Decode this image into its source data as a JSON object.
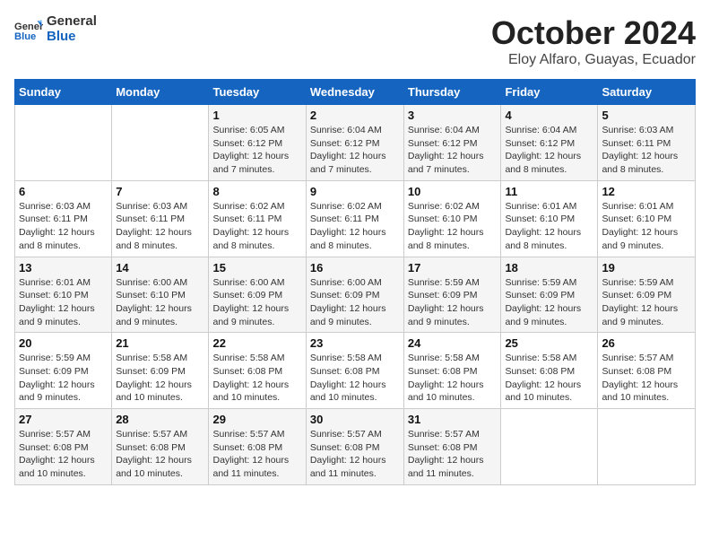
{
  "header": {
    "logo_line1": "General",
    "logo_line2": "Blue",
    "month_year": "October 2024",
    "location": "Eloy Alfaro, Guayas, Ecuador"
  },
  "calendar": {
    "days_of_week": [
      "Sunday",
      "Monday",
      "Tuesday",
      "Wednesday",
      "Thursday",
      "Friday",
      "Saturday"
    ],
    "weeks": [
      [
        {
          "day": "",
          "info": ""
        },
        {
          "day": "",
          "info": ""
        },
        {
          "day": "1",
          "info": "Sunrise: 6:05 AM\nSunset: 6:12 PM\nDaylight: 12 hours and 7 minutes."
        },
        {
          "day": "2",
          "info": "Sunrise: 6:04 AM\nSunset: 6:12 PM\nDaylight: 12 hours and 7 minutes."
        },
        {
          "day": "3",
          "info": "Sunrise: 6:04 AM\nSunset: 6:12 PM\nDaylight: 12 hours and 7 minutes."
        },
        {
          "day": "4",
          "info": "Sunrise: 6:04 AM\nSunset: 6:12 PM\nDaylight: 12 hours and 8 minutes."
        },
        {
          "day": "5",
          "info": "Sunrise: 6:03 AM\nSunset: 6:11 PM\nDaylight: 12 hours and 8 minutes."
        }
      ],
      [
        {
          "day": "6",
          "info": "Sunrise: 6:03 AM\nSunset: 6:11 PM\nDaylight: 12 hours and 8 minutes."
        },
        {
          "day": "7",
          "info": "Sunrise: 6:03 AM\nSunset: 6:11 PM\nDaylight: 12 hours and 8 minutes."
        },
        {
          "day": "8",
          "info": "Sunrise: 6:02 AM\nSunset: 6:11 PM\nDaylight: 12 hours and 8 minutes."
        },
        {
          "day": "9",
          "info": "Sunrise: 6:02 AM\nSunset: 6:11 PM\nDaylight: 12 hours and 8 minutes."
        },
        {
          "day": "10",
          "info": "Sunrise: 6:02 AM\nSunset: 6:10 PM\nDaylight: 12 hours and 8 minutes."
        },
        {
          "day": "11",
          "info": "Sunrise: 6:01 AM\nSunset: 6:10 PM\nDaylight: 12 hours and 8 minutes."
        },
        {
          "day": "12",
          "info": "Sunrise: 6:01 AM\nSunset: 6:10 PM\nDaylight: 12 hours and 9 minutes."
        }
      ],
      [
        {
          "day": "13",
          "info": "Sunrise: 6:01 AM\nSunset: 6:10 PM\nDaylight: 12 hours and 9 minutes."
        },
        {
          "day": "14",
          "info": "Sunrise: 6:00 AM\nSunset: 6:10 PM\nDaylight: 12 hours and 9 minutes."
        },
        {
          "day": "15",
          "info": "Sunrise: 6:00 AM\nSunset: 6:09 PM\nDaylight: 12 hours and 9 minutes."
        },
        {
          "day": "16",
          "info": "Sunrise: 6:00 AM\nSunset: 6:09 PM\nDaylight: 12 hours and 9 minutes."
        },
        {
          "day": "17",
          "info": "Sunrise: 5:59 AM\nSunset: 6:09 PM\nDaylight: 12 hours and 9 minutes."
        },
        {
          "day": "18",
          "info": "Sunrise: 5:59 AM\nSunset: 6:09 PM\nDaylight: 12 hours and 9 minutes."
        },
        {
          "day": "19",
          "info": "Sunrise: 5:59 AM\nSunset: 6:09 PM\nDaylight: 12 hours and 9 minutes."
        }
      ],
      [
        {
          "day": "20",
          "info": "Sunrise: 5:59 AM\nSunset: 6:09 PM\nDaylight: 12 hours and 9 minutes."
        },
        {
          "day": "21",
          "info": "Sunrise: 5:58 AM\nSunset: 6:09 PM\nDaylight: 12 hours and 10 minutes."
        },
        {
          "day": "22",
          "info": "Sunrise: 5:58 AM\nSunset: 6:08 PM\nDaylight: 12 hours and 10 minutes."
        },
        {
          "day": "23",
          "info": "Sunrise: 5:58 AM\nSunset: 6:08 PM\nDaylight: 12 hours and 10 minutes."
        },
        {
          "day": "24",
          "info": "Sunrise: 5:58 AM\nSunset: 6:08 PM\nDaylight: 12 hours and 10 minutes."
        },
        {
          "day": "25",
          "info": "Sunrise: 5:58 AM\nSunset: 6:08 PM\nDaylight: 12 hours and 10 minutes."
        },
        {
          "day": "26",
          "info": "Sunrise: 5:57 AM\nSunset: 6:08 PM\nDaylight: 12 hours and 10 minutes."
        }
      ],
      [
        {
          "day": "27",
          "info": "Sunrise: 5:57 AM\nSunset: 6:08 PM\nDaylight: 12 hours and 10 minutes."
        },
        {
          "day": "28",
          "info": "Sunrise: 5:57 AM\nSunset: 6:08 PM\nDaylight: 12 hours and 10 minutes."
        },
        {
          "day": "29",
          "info": "Sunrise: 5:57 AM\nSunset: 6:08 PM\nDaylight: 12 hours and 11 minutes."
        },
        {
          "day": "30",
          "info": "Sunrise: 5:57 AM\nSunset: 6:08 PM\nDaylight: 12 hours and 11 minutes."
        },
        {
          "day": "31",
          "info": "Sunrise: 5:57 AM\nSunset: 6:08 PM\nDaylight: 12 hours and 11 minutes."
        },
        {
          "day": "",
          "info": ""
        },
        {
          "day": "",
          "info": ""
        }
      ]
    ]
  }
}
